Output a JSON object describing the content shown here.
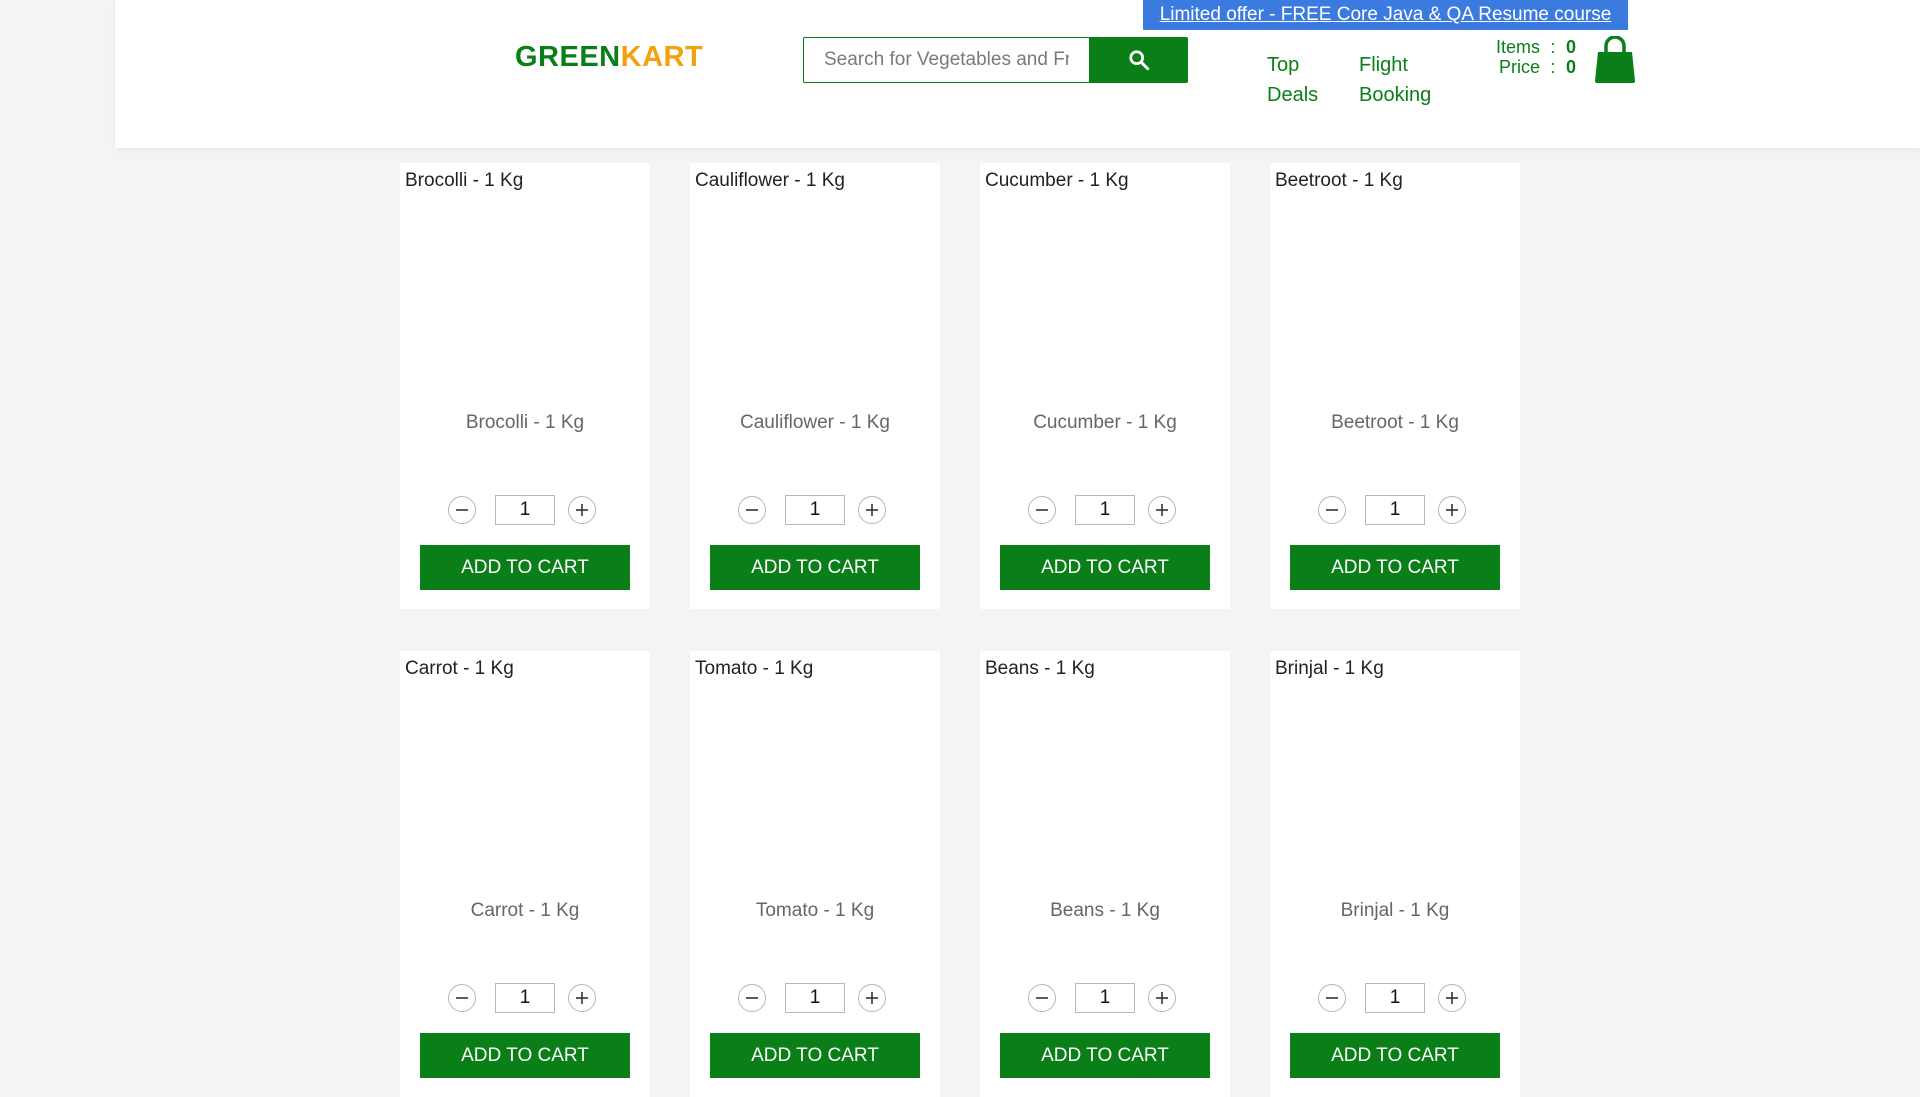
{
  "header": {
    "promo": "Limited offer - FREE Core Java & QA Resume course",
    "brand": {
      "part1": "GREEN",
      "part2": "KART"
    },
    "search": {
      "placeholder": "Search for Vegetables and Fruits",
      "value": "",
      "icon": "search-icon"
    },
    "nav": {
      "top_deals": [
        "Top",
        "Deals"
      ],
      "flight_booking": [
        "Flight",
        "Booking"
      ]
    },
    "cart": {
      "items_label": "Items",
      "items_value": "0",
      "price_label": "Price",
      "price_value": "0",
      "separator": ":",
      "icon": "shopping-bag-icon"
    }
  },
  "products": [
    {
      "name": "Brocolli - 1 Kg",
      "caption": "Brocolli - 1 Kg",
      "quantity": "1",
      "button": "ADD TO CART"
    },
    {
      "name": "Cauliflower - 1 Kg",
      "caption": "Cauliflower - 1 Kg",
      "quantity": "1",
      "button": "ADD TO CART"
    },
    {
      "name": "Cucumber - 1 Kg",
      "caption": "Cucumber - 1 Kg",
      "quantity": "1",
      "button": "ADD TO CART"
    },
    {
      "name": "Beetroot - 1 Kg",
      "caption": "Beetroot - 1 Kg",
      "quantity": "1",
      "button": "ADD TO CART"
    },
    {
      "name": "Carrot - 1 Kg",
      "caption": "Carrot - 1 Kg",
      "quantity": "1",
      "button": "ADD TO CART"
    },
    {
      "name": "Tomato - 1 Kg",
      "caption": "Tomato - 1 Kg",
      "quantity": "1",
      "button": "ADD TO CART"
    },
    {
      "name": "Beans - 1 Kg",
      "caption": "Beans - 1 Kg",
      "quantity": "1",
      "button": "ADD TO CART"
    },
    {
      "name": "Brinjal - 1 Kg",
      "caption": "Brinjal - 1 Kg",
      "quantity": "1",
      "button": "ADD TO CART"
    }
  ],
  "colors": {
    "brand_green": "#0a7f18",
    "brand_orange": "#f2a20c",
    "promo_blue": "#3b7be0",
    "page_background": "#f4f4f4"
  }
}
